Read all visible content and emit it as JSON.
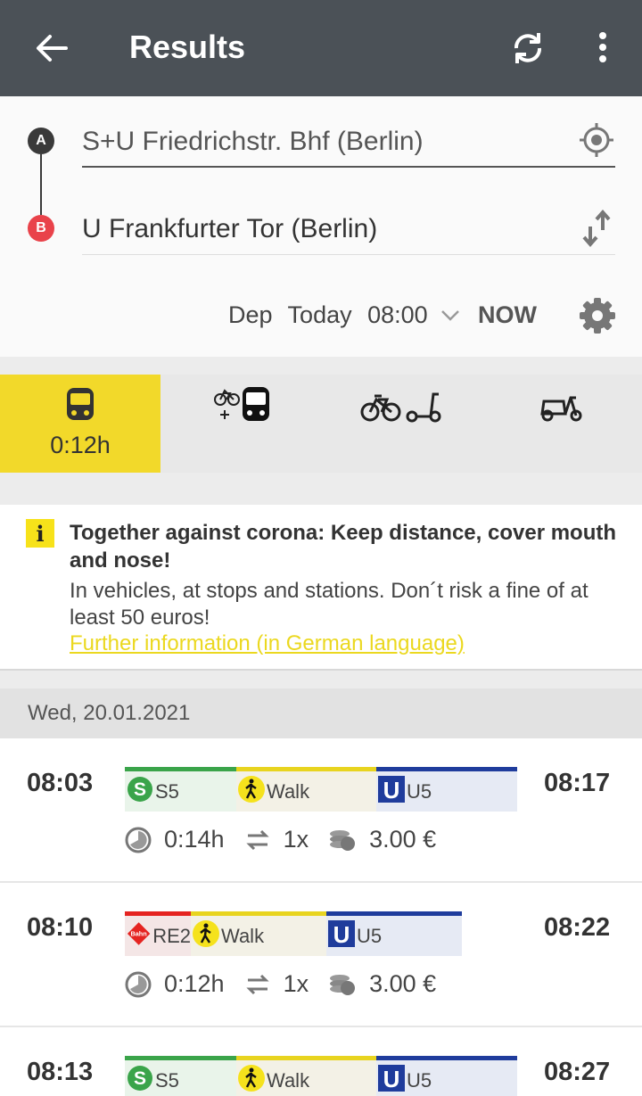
{
  "appbar": {
    "title": "Results",
    "back_icon": "arrow-left-icon",
    "refresh_icon": "refresh-icon",
    "more_icon": "more-vert-icon"
  },
  "form": {
    "from_badge": "A",
    "to_badge": "B",
    "from": "S+U Friedrichstr. Bhf (Berlin)",
    "to": "U Frankfurter Tor (Berlin)",
    "dep_label": "Dep",
    "day": "Today",
    "time": "08:00",
    "now_label": "NOW"
  },
  "modes": [
    {
      "icon": "public-transport-icon",
      "time": "0:12h",
      "active": true
    },
    {
      "icon": "bike-and-transit-icon",
      "active": false
    },
    {
      "icon": "bike-and-scooter-icon",
      "active": false
    },
    {
      "icon": "moped-icon",
      "active": false
    }
  ],
  "notice": {
    "title": "Together against corona: Keep distance, cover mouth and nose!",
    "body": "In vehicles, at stops and stations. Don´t risk a fine of at least 50 euros!",
    "link": "Further information (in German language)",
    "icon": "info-icon"
  },
  "date_header": "Wed, 20.01.2021",
  "colors": {
    "appbar": "#4b5157",
    "accent": "#f2d92a",
    "sbahn": "#3aa44a",
    "ubahn": "#1f3c9c",
    "walk": "#e8d41f",
    "db": "#e52421"
  },
  "trips": [
    {
      "dep": "08:03",
      "arr": "08:17",
      "segments": [
        {
          "icon": "s-bahn-icon",
          "label": "S5"
        },
        {
          "icon": "walk-icon",
          "label": "Walk"
        },
        {
          "icon": "u-bahn-icon",
          "label": "U5"
        }
      ],
      "duration": "0:14h",
      "changes": "1x",
      "price": "3.00 €"
    },
    {
      "dep": "08:10",
      "arr": "08:22",
      "segments": [
        {
          "icon": "db-bahn-icon",
          "badge": "Bahn",
          "label": "RE2"
        },
        {
          "icon": "walk-icon",
          "label": "Walk"
        },
        {
          "icon": "u-bahn-icon",
          "label": "U5"
        }
      ],
      "duration": "0:12h",
      "changes": "1x",
      "price": "3.00 €"
    },
    {
      "dep": "08:13",
      "arr": "08:27",
      "segments": [
        {
          "icon": "s-bahn-icon",
          "label": "S5"
        },
        {
          "icon": "walk-icon",
          "label": "Walk"
        },
        {
          "icon": "u-bahn-icon",
          "label": "U5"
        }
      ]
    }
  ]
}
